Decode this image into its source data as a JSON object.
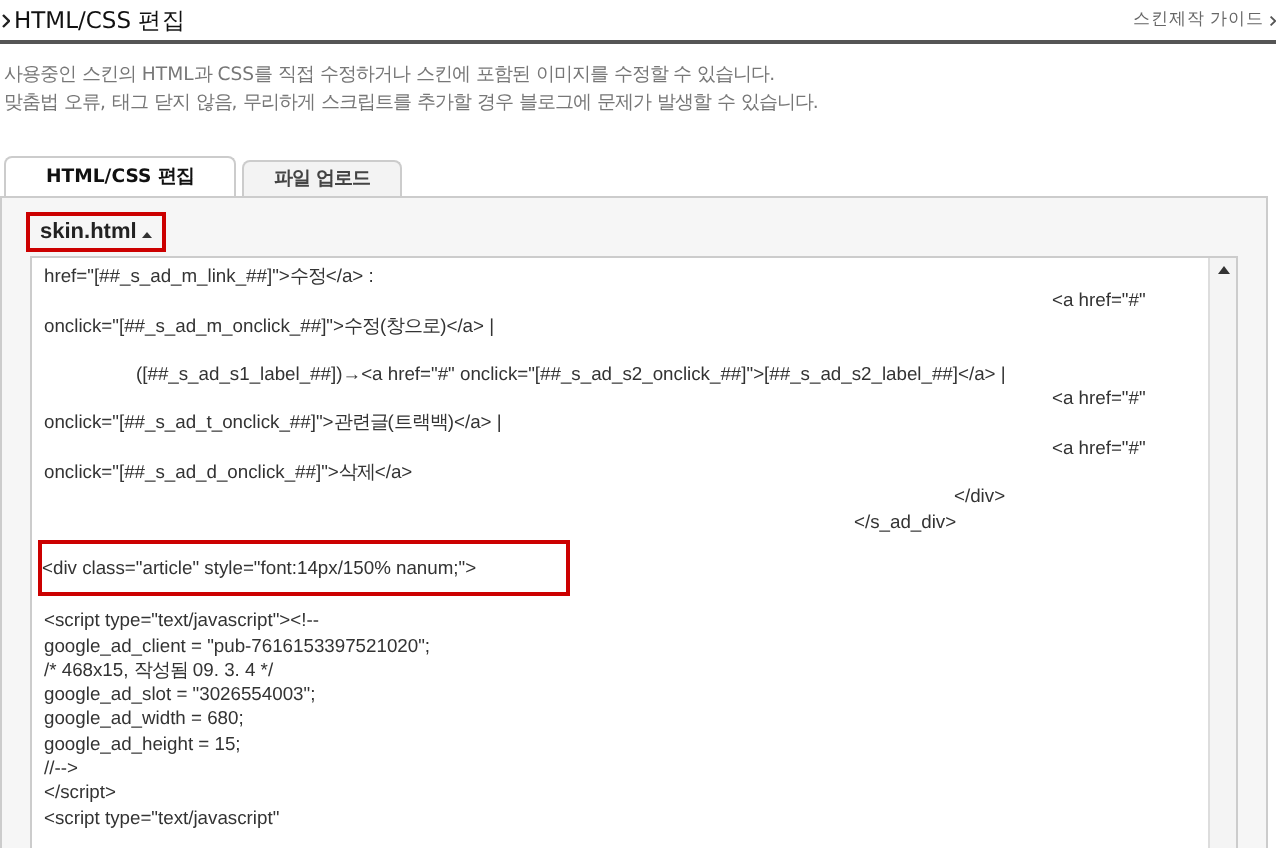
{
  "header": {
    "title": "HTML/CSS 편집",
    "guide_link": "스킨제작 가이드"
  },
  "description": [
    "사용중인 스킨의 HTML과 CSS를 직접 수정하거나 스킨에 포함된 이미지를 수정할 수 있습니다.",
    "맞춤법 오류, 태그 닫지 않음, 무리하게 스크립트를 추가할 경우 블로그에 문제가 발생할 수 있습니다."
  ],
  "tabs": [
    {
      "label": "HTML/CSS 편집",
      "selected": true
    },
    {
      "label": "파일 업로드",
      "selected": false
    }
  ],
  "file_selector": {
    "label": "skin.html",
    "highlighted": true
  },
  "code_lines": [
    {
      "kind": "left",
      "text": "href=\"[##_s_ad_m_link_##]\">수정</a> :",
      "highlighted": false
    },
    {
      "kind": "far",
      "text": "<a href=\"#\"",
      "highlighted": false
    },
    {
      "kind": "left",
      "text": "onclick=\"[##_s_ad_m_onclick_##]\">수정(창으로)</a> |",
      "highlighted": false
    },
    {
      "kind": "gap-indent",
      "text": "([##_s_ad_s1_label_##])→<a href=\"#\" onclick=\"[##_s_ad_s2_onclick_##]\">[##_s_ad_s2_label_##]</a> |",
      "highlighted": false
    },
    {
      "kind": "far",
      "text": "<a href=\"#\"",
      "highlighted": false
    },
    {
      "kind": "left",
      "text": "onclick=\"[##_s_ad_t_onclick_##]\">관련글(트랙백)</a> |",
      "highlighted": false
    },
    {
      "kind": "far",
      "text": "<a href=\"#\"",
      "highlighted": false
    },
    {
      "kind": "left",
      "text": "onclick=\"[##_s_ad_d_onclick_##]\">삭제</a>",
      "highlighted": false
    },
    {
      "kind": "mid",
      "text": "</div>",
      "highlighted": false
    },
    {
      "kind": "near",
      "text": "</s_ad_div>",
      "highlighted": false
    },
    {
      "kind": "left",
      "text": "<div class=\"article\" style=\"font:14px/150% nanum;\">",
      "highlighted": true
    },
    {
      "kind": "left",
      "text": "<script type=\"text/javascript\"><!--",
      "highlighted": false
    },
    {
      "kind": "left",
      "text": "google_ad_client = \"pub-7616153397521020\";",
      "highlighted": false
    },
    {
      "kind": "left",
      "text": "/* 468x15, 작성됨 09. 3. 4 */",
      "highlighted": false
    },
    {
      "kind": "left",
      "text": "google_ad_slot = \"3026554003\";",
      "highlighted": false
    },
    {
      "kind": "left",
      "text": "google_ad_width = 680;",
      "highlighted": false
    },
    {
      "kind": "left",
      "text": "google_ad_height = 15;",
      "highlighted": false
    },
    {
      "kind": "left",
      "text": "//-->",
      "highlighted": false
    },
    {
      "kind": "left",
      "text": "</script>",
      "highlighted": false
    },
    {
      "kind": "left",
      "text": "<script type=\"text/javascript\"",
      "highlighted": false
    }
  ]
}
